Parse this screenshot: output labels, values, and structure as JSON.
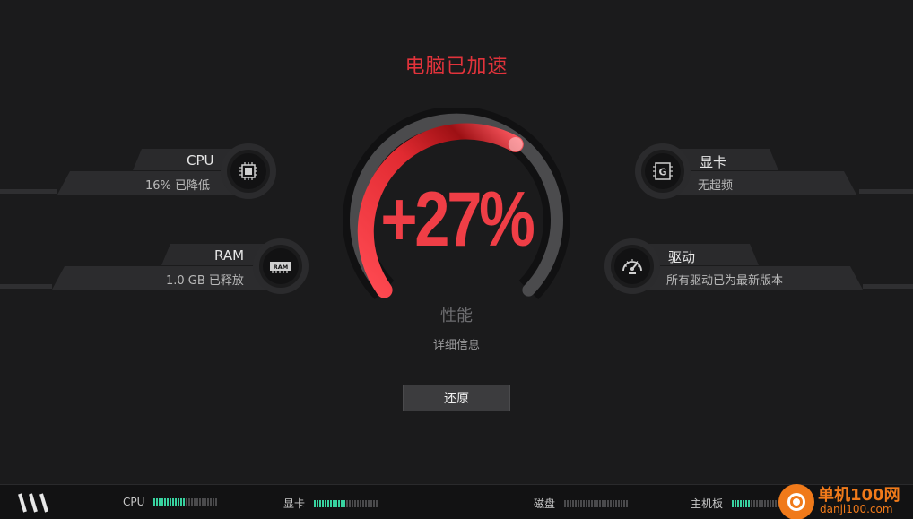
{
  "header": {
    "title": "电脑已加速"
  },
  "gauge": {
    "percent_text": "+27%",
    "label": "性能",
    "detail_link": "详细信息",
    "fill_fraction": 0.27
  },
  "restore_button": {
    "label": "还原"
  },
  "left_stats": [
    {
      "name": "CPU",
      "value": "16% 已降低",
      "icon": "cpu-chip-icon"
    },
    {
      "name": "RAM",
      "value": "1.0 GB 已释放",
      "icon": "ram-module-icon"
    }
  ],
  "right_stats": [
    {
      "name": "显卡",
      "value": "无超频",
      "icon": "gpu-g-icon"
    },
    {
      "name": "驱动",
      "value": "所有驱动已为最新版本",
      "icon": "speedometer-icon"
    }
  ],
  "statusbar": {
    "items": [
      {
        "label": "CPU",
        "level": 0.5
      },
      {
        "label": "显卡",
        "level": 0.5
      },
      {
        "label": "磁盘",
        "level": 0.0
      },
      {
        "label": "主机板",
        "level": 0.3
      }
    ]
  },
  "watermark": {
    "title": "单机100网",
    "subtitle": "danji100.com"
  },
  "colors": {
    "accent": "#e2333b",
    "meter_on": "#38d3a0",
    "background": "#1b1b1c"
  }
}
